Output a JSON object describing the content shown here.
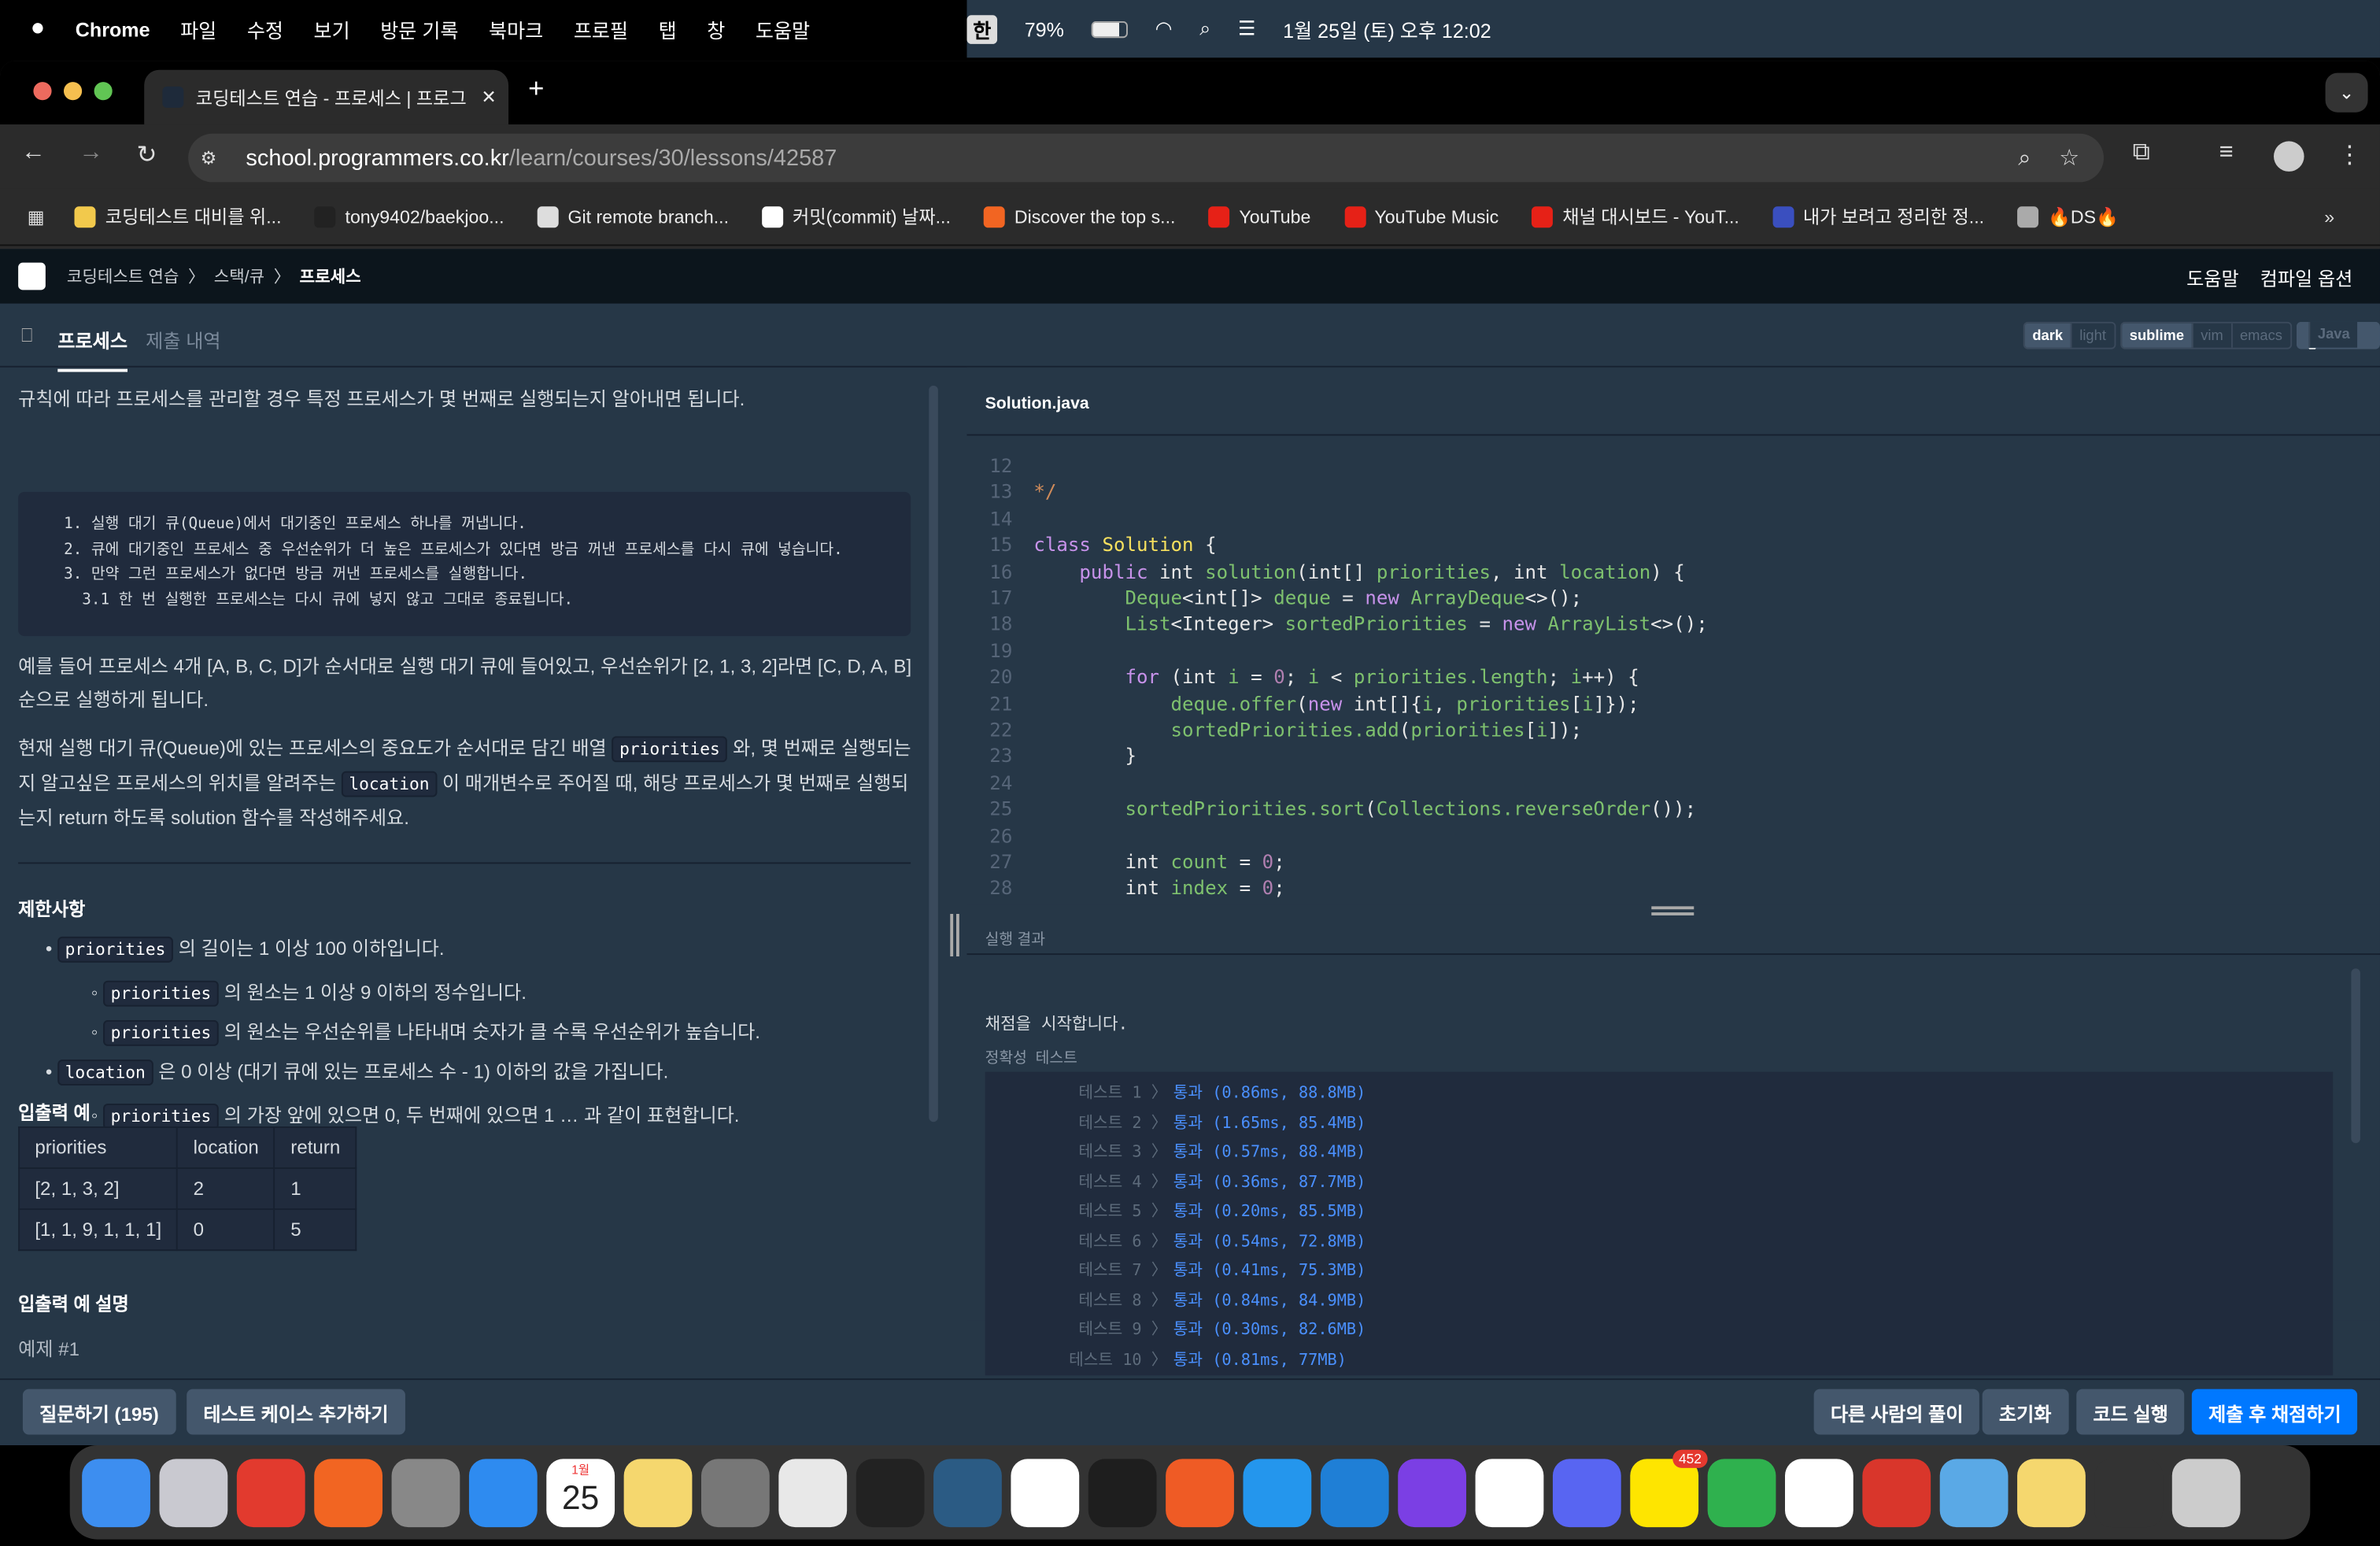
{
  "menubar": {
    "app": "Chrome",
    "items": [
      "파일",
      "수정",
      "보기",
      "방문 기록",
      "북마크",
      "프로필",
      "탭",
      "창",
      "도움말"
    ],
    "input_method": "한",
    "battery": "79%",
    "datetime": "1월 25일 (토) 오후 12:02"
  },
  "browser": {
    "tab_title": "코딩테스트 연습 - 프로세스 | 프로그",
    "url_host": "school.programmers.co.kr",
    "url_path": "/learn/courses/30/lessons/42587",
    "bookmarks": [
      {
        "label": "코딩테스트 대비를 위...",
        "color": "#f2c94c"
      },
      {
        "label": "tony9402/baekjoo...",
        "color": "#222"
      },
      {
        "label": "Git remote branch...",
        "color": "#ddd"
      },
      {
        "label": "커밋(commit) 날짜...",
        "color": "#fff"
      },
      {
        "label": "Discover the top s...",
        "color": "#f26522"
      },
      {
        "label": "YouTube",
        "color": "#e62117"
      },
      {
        "label": "YouTube Music",
        "color": "#e62117"
      },
      {
        "label": "채널 대시보드 - YouT...",
        "color": "#e62117"
      },
      {
        "label": "내가 보려고 정리한 정...",
        "color": "#3a4fbf"
      },
      {
        "label": "🔥DS🔥",
        "color": "#aaa"
      }
    ]
  },
  "header": {
    "breadcrumb": [
      "코딩테스트 연습",
      "스택/큐",
      "프로세스"
    ],
    "help": "도움말",
    "compile_options": "컴파일 옵션"
  },
  "tabs": {
    "problem": "프로세스",
    "submissions": "제출 내역"
  },
  "editor_options": {
    "theme": [
      "dark",
      "light"
    ],
    "theme_selected": "dark",
    "keymap": [
      "sublime",
      "vim",
      "emacs"
    ],
    "keymap_selected": "sublime",
    "language": "Java"
  },
  "problem": {
    "intro": "규칙에 따라 프로세스를 관리할 경우 특정 프로세스가 몇 번째로 실행되는지 알아내면 됩니다.",
    "rules": "  1. 실행 대기 큐(Queue)에서 대기중인 프로세스 하나를 꺼냅니다.\n  2. 큐에 대기중인 프로세스 중 우선순위가 더 높은 프로세스가 있다면 방금 꺼낸 프로세스를 다시 큐에 넣습니다.\n  3. 만약 그런 프로세스가 없다면 방금 꺼낸 프로세스를 실행합니다.\n    3.1 한 번 실행한 프로세스는 다시 큐에 넣지 않고 그대로 종료됩니다.",
    "example": "예를 들어 프로세스 4개 [A, B, C, D]가 순서대로 실행 대기 큐에 들어있고, 우선순위가 [2, 1, 3, 2]라면 [C, D, A, B] 순으로 실행하게 됩니다.",
    "desc_1": "현재 실행 대기 큐(Queue)에 있는 프로세스의 중요도가 순서대로 담긴 배열",
    "desc_code1": "priorities",
    "desc_2": "와, 몇 번째로 실행되는지 알고싶은 프로세스의 위치를 알려주는",
    "desc_code2": "location",
    "desc_3": "이 매개변수로 주어질 때, 해당 프로세스가 몇 번째로 실행되는지 return 하도록 solution 함수를 작성해주세요.",
    "constraints_title": "제한사항",
    "constraints": [
      {
        "code": "priorities",
        "text": "의 길이는 1 이상 100 이하입니다."
      },
      {
        "code": "priorities",
        "text": "의 원소는 1 이상 9 이하의 정수입니다."
      },
      {
        "code": "priorities",
        "text": "의 원소는 우선순위를 나타내며 숫자가 클 수록 우선순위가 높습니다."
      },
      {
        "code": "location",
        "text": "은 0 이상 (대기 큐에 있는 프로세스 수 - 1) 이하의 값을 가집니다."
      },
      {
        "code": "priorities",
        "text": "의 가장 앞에 있으면 0, 두 번째에 있으면 1 … 과 같이 표현합니다."
      }
    ],
    "io_title": "입출력 예",
    "io_headers": [
      "priorities",
      "location",
      "return"
    ],
    "io_rows": [
      [
        "[2, 1, 3, 2]",
        "2",
        "1"
      ],
      [
        "[1, 1, 9, 1, 1, 1]",
        "0",
        "5"
      ]
    ],
    "io_desc_title": "입출력 예 설명",
    "example1": "예제 #1"
  },
  "code": {
    "filename": "Solution.java",
    "lines": [
      {
        "n": "12",
        "tokens": []
      },
      {
        "n": "13",
        "tokens": [
          {
            "t": "*/",
            "c": "cm"
          }
        ]
      },
      {
        "n": "14",
        "tokens": []
      },
      {
        "n": "15",
        "tokens": [
          {
            "t": "class ",
            "c": "k"
          },
          {
            "t": "Solution",
            "c": "y"
          },
          {
            "t": " {",
            "c": "t"
          }
        ]
      },
      {
        "n": "16",
        "tokens": [
          {
            "t": "    public ",
            "c": "k"
          },
          {
            "t": "int ",
            "c": "t"
          },
          {
            "t": "solution",
            "c": "f"
          },
          {
            "t": "(int[] ",
            "c": "t"
          },
          {
            "t": "priorities",
            "c": "f"
          },
          {
            "t": ", int ",
            "c": "t"
          },
          {
            "t": "location",
            "c": "f"
          },
          {
            "t": ") {",
            "c": "t"
          }
        ]
      },
      {
        "n": "17",
        "tokens": [
          {
            "t": "        Deque",
            "c": "f"
          },
          {
            "t": "<int[]> ",
            "c": "t"
          },
          {
            "t": "deque",
            "c": "f"
          },
          {
            "t": " = ",
            "c": "t"
          },
          {
            "t": "new ",
            "c": "k"
          },
          {
            "t": "ArrayDeque",
            "c": "f"
          },
          {
            "t": "<>();",
            "c": "t"
          }
        ]
      },
      {
        "n": "18",
        "tokens": [
          {
            "t": "        List",
            "c": "f"
          },
          {
            "t": "<Integer> ",
            "c": "t"
          },
          {
            "t": "sortedPriorities",
            "c": "f"
          },
          {
            "t": " = ",
            "c": "t"
          },
          {
            "t": "new ",
            "c": "k"
          },
          {
            "t": "ArrayList",
            "c": "f"
          },
          {
            "t": "<>();",
            "c": "t"
          }
        ]
      },
      {
        "n": "19",
        "tokens": []
      },
      {
        "n": "20",
        "tokens": [
          {
            "t": "        for ",
            "c": "k"
          },
          {
            "t": "(int ",
            "c": "t"
          },
          {
            "t": "i",
            "c": "f"
          },
          {
            "t": " = ",
            "c": "t"
          },
          {
            "t": "0",
            "c": "n"
          },
          {
            "t": "; ",
            "c": "t"
          },
          {
            "t": "i",
            "c": "f"
          },
          {
            "t": " < ",
            "c": "t"
          },
          {
            "t": "priorities.length",
            "c": "f"
          },
          {
            "t": "; ",
            "c": "t"
          },
          {
            "t": "i",
            "c": "f"
          },
          {
            "t": "++) {",
            "c": "t"
          }
        ]
      },
      {
        "n": "21",
        "tokens": [
          {
            "t": "            deque.offer",
            "c": "f"
          },
          {
            "t": "(",
            "c": "t"
          },
          {
            "t": "new ",
            "c": "k"
          },
          {
            "t": "int[]{",
            "c": "t"
          },
          {
            "t": "i",
            "c": "f"
          },
          {
            "t": ", ",
            "c": "t"
          },
          {
            "t": "priorities",
            "c": "f"
          },
          {
            "t": "[",
            "c": "t"
          },
          {
            "t": "i",
            "c": "f"
          },
          {
            "t": "]});",
            "c": "t"
          }
        ]
      },
      {
        "n": "22",
        "tokens": [
          {
            "t": "            sortedPriorities.add",
            "c": "f"
          },
          {
            "t": "(",
            "c": "t"
          },
          {
            "t": "priorities",
            "c": "f"
          },
          {
            "t": "[",
            "c": "t"
          },
          {
            "t": "i",
            "c": "f"
          },
          {
            "t": "]);",
            "c": "t"
          }
        ]
      },
      {
        "n": "23",
        "tokens": [
          {
            "t": "        }",
            "c": "t"
          }
        ]
      },
      {
        "n": "24",
        "tokens": []
      },
      {
        "n": "25",
        "tokens": [
          {
            "t": "        sortedPriorities.sort",
            "c": "f"
          },
          {
            "t": "(",
            "c": "t"
          },
          {
            "t": "Collections.reverseOrder",
            "c": "f"
          },
          {
            "t": "());",
            "c": "t"
          }
        ]
      },
      {
        "n": "26",
        "tokens": []
      },
      {
        "n": "27",
        "tokens": [
          {
            "t": "        int ",
            "c": "t"
          },
          {
            "t": "count",
            "c": "f"
          },
          {
            "t": " = ",
            "c": "t"
          },
          {
            "t": "0",
            "c": "n"
          },
          {
            "t": ";",
            "c": "t"
          }
        ]
      },
      {
        "n": "28",
        "tokens": [
          {
            "t": "        int ",
            "c": "t"
          },
          {
            "t": "index",
            "c": "f"
          },
          {
            "t": " = ",
            "c": "t"
          },
          {
            "t": "0",
            "c": "n"
          },
          {
            "t": ";",
            "c": "t"
          }
        ]
      }
    ]
  },
  "results": {
    "title": "실행 결과",
    "start": "채점을 시작합니다.",
    "section": "정확성  테스트",
    "tests": [
      {
        "label": "테스트 1 〉",
        "result": "통과 (0.86ms, 88.8MB)"
      },
      {
        "label": "테스트 2 〉",
        "result": "통과 (1.65ms, 85.4MB)"
      },
      {
        "label": "테스트 3 〉",
        "result": "통과 (0.57ms, 88.4MB)"
      },
      {
        "label": "테스트 4 〉",
        "result": "통과 (0.36ms, 87.7MB)"
      },
      {
        "label": "테스트 5 〉",
        "result": "통과 (0.20ms, 85.5MB)"
      },
      {
        "label": "테스트 6 〉",
        "result": "통과 (0.54ms, 72.8MB)"
      },
      {
        "label": "테스트 7 〉",
        "result": "통과 (0.41ms, 75.3MB)"
      },
      {
        "label": "테스트 8 〉",
        "result": "통과 (0.84ms, 84.9MB)"
      },
      {
        "label": "테스트 9 〉",
        "result": "통과 (0.30ms, 82.6MB)"
      },
      {
        "label": "테스트 10 〉",
        "result": "통과 (0.81ms, 77MB)"
      }
    ]
  },
  "bottom": {
    "ask": "질문하기 (195)",
    "add_testcase": "테스트 케이스 추가하기",
    "others": "다른 사람의 풀이",
    "reset": "초기화",
    "run": "코드 실행",
    "submit": "제출 후 채점하기"
  },
  "dock": {
    "apps": [
      {
        "name": "finder",
        "color": "#3d8ef0"
      },
      {
        "name": "launchpad",
        "color": "#c9c9d0"
      },
      {
        "name": "infuse",
        "color": "#e23a2e"
      },
      {
        "name": "soundcloud",
        "color": "#f26522"
      },
      {
        "name": "disk-utility",
        "color": "#888"
      },
      {
        "name": "safari",
        "color": "#2e8bf0"
      },
      {
        "name": "calendar",
        "color": "#ffffff"
      },
      {
        "name": "notes",
        "color": "#f5d76e"
      },
      {
        "name": "system-settings",
        "color": "#777"
      },
      {
        "name": "chrome",
        "color": "#e8e8e8"
      },
      {
        "name": "terminal",
        "color": "#222"
      },
      {
        "name": "mysql-workbench",
        "color": "#2b5b84"
      },
      {
        "name": "notion",
        "color": "#fff"
      },
      {
        "name": "figma",
        "color": "#1e1e1e"
      },
      {
        "name": "postman",
        "color": "#ef5b25"
      },
      {
        "name": "docker",
        "color": "#2496ed"
      },
      {
        "name": "vscode",
        "color": "#1f7fd6"
      },
      {
        "name": "intellij",
        "color": "#7b3fe4"
      },
      {
        "name": "slack",
        "color": "#fff"
      },
      {
        "name": "discord",
        "color": "#5865f2"
      },
      {
        "name": "kakaotalk",
        "color": "#fee500",
        "badge": "452"
      },
      {
        "name": "numbers",
        "color": "#2fb14e"
      },
      {
        "name": "bear",
        "color": "#fff"
      },
      {
        "name": "photo-booth",
        "color": "#d9362b"
      },
      {
        "name": "downloads",
        "color": "#5aa9e6"
      },
      {
        "name": "notes-stack",
        "color": "#f5d76e"
      },
      {
        "name": "activity-stack",
        "color": "#333"
      },
      {
        "name": "trash",
        "color": "#ccc"
      }
    ],
    "calendar_month": "1월",
    "calendar_day": "25"
  }
}
